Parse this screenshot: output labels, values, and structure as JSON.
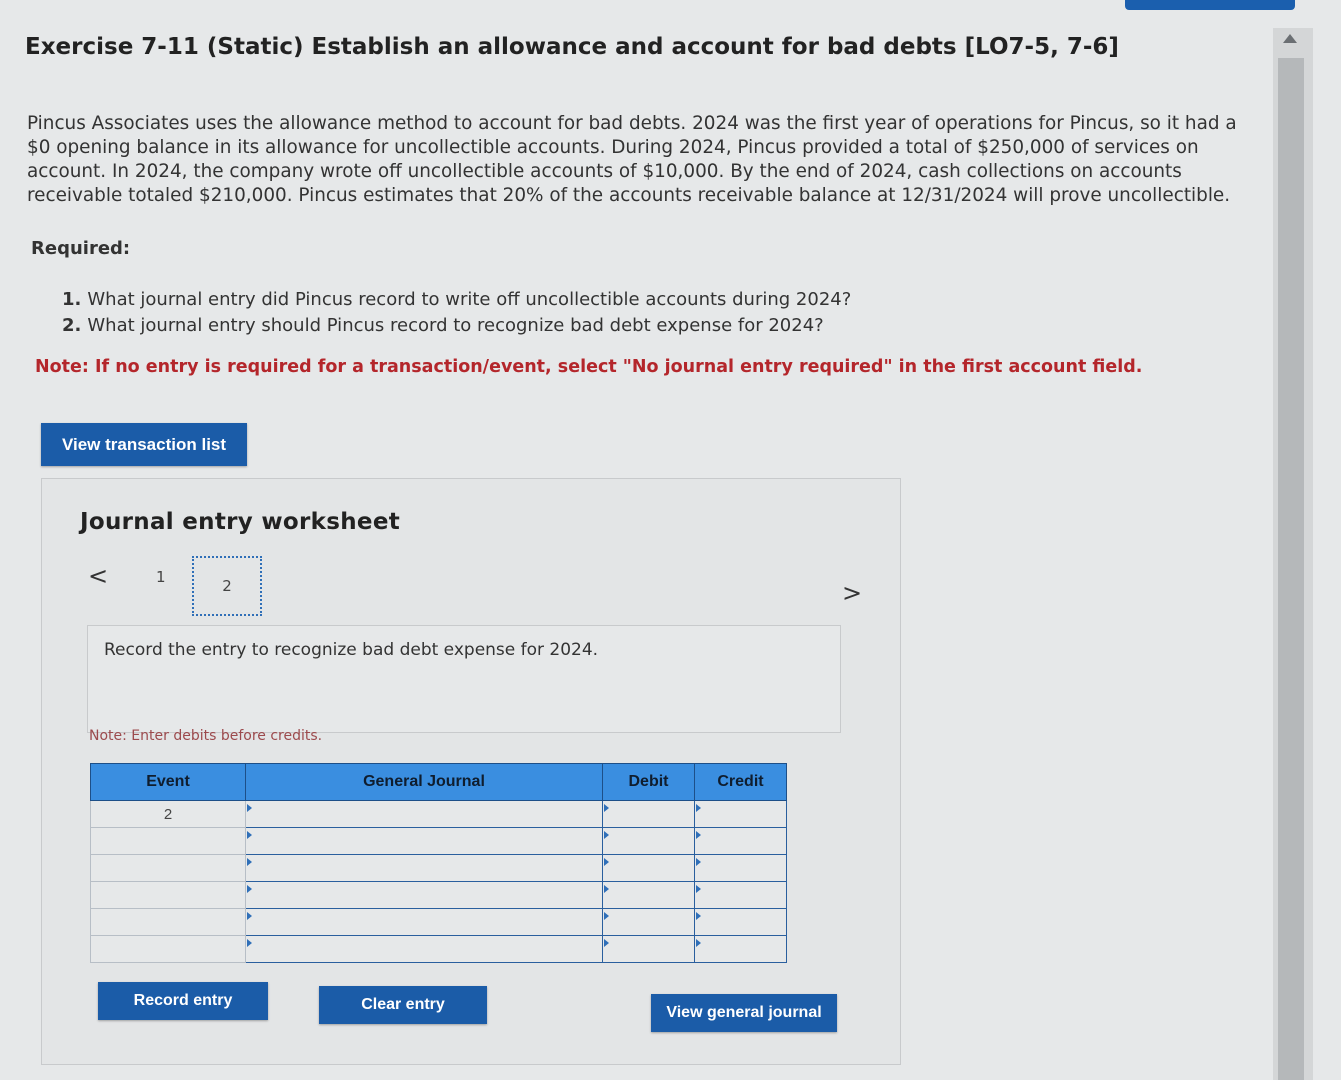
{
  "header": {
    "title": "Exercise 7-11 (Static) Establish an allowance and account for bad debts [LO7-5, 7-6]"
  },
  "problem": {
    "intro": "Pincus Associates uses the allowance method to account for bad debts. 2024 was the first year of operations for Pincus, so it had a $0 opening balance in its allowance for uncollectible accounts. During 2024, Pincus provided a total of $250,000 of services on account. In 2024, the company wrote off uncollectible accounts of $10,000. By the end of 2024, cash collections on accounts receivable totaled $210,000. Pincus estimates that 20% of the accounts receivable balance at 12/31/2024 will prove uncollectible.",
    "required_label": "Required:",
    "questions": [
      {
        "num": "1.",
        "text": "What journal entry did Pincus record to write off uncollectible accounts during 2024?"
      },
      {
        "num": "2.",
        "text": "What journal entry should Pincus record to recognize bad debt expense for 2024?"
      }
    ],
    "note": "Note: If no entry is required for a transaction/event, select \"No journal entry required\" in the first account field."
  },
  "buttons": {
    "view_transaction_list": "View transaction list",
    "record_entry": "Record entry",
    "clear_entry": "Clear entry",
    "view_general_journal": "View general journal"
  },
  "worksheet": {
    "title": "Journal entry worksheet",
    "prev_arrow": "<",
    "next_arrow": ">",
    "pages": [
      "1",
      "2"
    ],
    "current_page": "2",
    "instruction": "Record the entry to recognize bad debt expense for 2024.",
    "note": "Note: Enter debits before credits.",
    "table": {
      "headers": {
        "event": "Event",
        "general_journal": "General Journal",
        "debit": "Debit",
        "credit": "Credit"
      },
      "rows": [
        {
          "event": "2",
          "account": "",
          "debit": "",
          "credit": ""
        },
        {
          "event": "",
          "account": "",
          "debit": "",
          "credit": ""
        },
        {
          "event": "",
          "account": "",
          "debit": "",
          "credit": ""
        },
        {
          "event": "",
          "account": "",
          "debit": "",
          "credit": ""
        },
        {
          "event": "",
          "account": "",
          "debit": "",
          "credit": ""
        },
        {
          "event": "",
          "account": "",
          "debit": "",
          "credit": ""
        }
      ]
    }
  },
  "colors": {
    "accent": "#1b5ca8",
    "table_header": "#3a8ee0",
    "note_red": "#b4262b"
  }
}
